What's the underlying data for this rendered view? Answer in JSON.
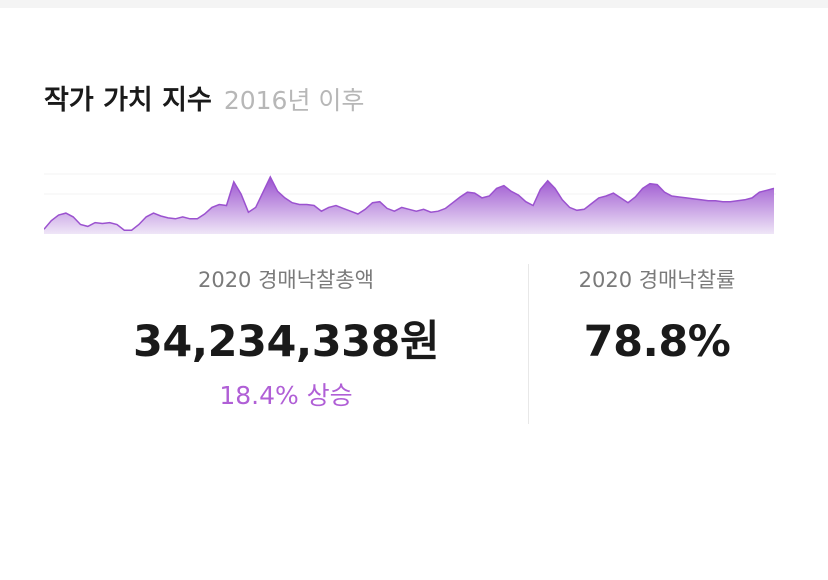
{
  "header": {
    "title": "작가 가치 지수",
    "subtitle": "2016년 이후"
  },
  "stats": {
    "total": {
      "label": "2020 경매낙찰총액",
      "value": "34,234,338원",
      "change": "18.4% 상승"
    },
    "rate": {
      "label": "2020 경매낙찰률",
      "value": "78.8%"
    }
  },
  "colors": {
    "accent": "#b05fd6",
    "area_top": "#9b52cf",
    "area_bottom": "#efe6f7"
  },
  "chart_data": {
    "type": "area",
    "values": [
      5,
      14,
      20,
      22,
      18,
      10,
      8,
      12,
      11,
      12,
      10,
      4,
      4,
      10,
      18,
      22,
      19,
      17,
      16,
      18,
      16,
      16,
      21,
      28,
      31,
      30,
      55,
      42,
      23,
      28,
      44,
      60,
      45,
      38,
      33,
      31,
      31,
      30,
      24,
      28,
      30,
      27,
      24,
      21,
      26,
      33,
      34,
      27,
      24,
      28,
      26,
      24,
      26,
      23,
      24,
      27,
      33,
      39,
      44,
      43,
      38,
      40,
      48,
      51,
      45,
      41,
      34,
      30,
      47,
      56,
      48,
      36,
      28,
      25,
      26,
      32,
      38,
      40,
      43,
      38,
      33,
      39,
      48,
      53,
      52,
      44,
      40,
      39,
      38,
      37,
      36,
      35,
      35,
      34,
      34,
      35,
      36,
      38,
      44,
      46,
      48
    ]
  }
}
